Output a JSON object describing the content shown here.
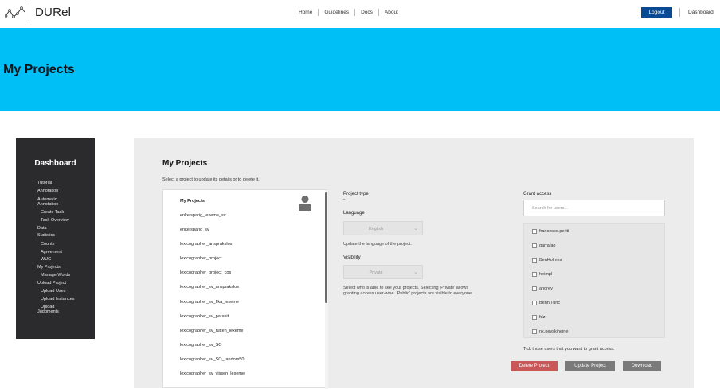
{
  "app": {
    "name": "DURel"
  },
  "nav": {
    "links": [
      "Home",
      "Guidelines",
      "Docs",
      "About"
    ],
    "logout_label": "Logout",
    "dashboard_label": "Dashboard"
  },
  "banner": {
    "title": "My Projects"
  },
  "sidebar": {
    "title": "Dashboard",
    "items": [
      {
        "label": "Tutorial",
        "indent": 0
      },
      {
        "label": "Annotation",
        "indent": 0
      },
      {
        "label": "Automatic",
        "indent": 0
      },
      {
        "label": "Annotation",
        "indent": 0
      },
      {
        "label": "Create Task",
        "indent": 1
      },
      {
        "label": "Task Overview",
        "indent": 1
      },
      {
        "label": "Data",
        "indent": 0
      },
      {
        "label": "Statistics",
        "indent": 0
      },
      {
        "label": "Counts",
        "indent": 1
      },
      {
        "label": "Agreement",
        "indent": 1
      },
      {
        "label": "WUG",
        "indent": 1
      },
      {
        "label": "My Projects",
        "indent": 0
      },
      {
        "label": "Manage Words",
        "indent": 1
      },
      {
        "label": "Upload Project",
        "indent": 0
      },
      {
        "label": "Upload Uses",
        "indent": 1
      },
      {
        "label": "Upload Instances",
        "indent": 1
      },
      {
        "label": "Upload",
        "indent": 1
      },
      {
        "label": "Judgments",
        "indent": 1
      }
    ]
  },
  "main": {
    "title": "My Projects",
    "subtitle": "Select a project to update its details or to delete it.",
    "projects": [
      "My Projects",
      "enkelsparig_lexeme_sv",
      "enkelsparig_sv",
      "lexicographer_ansprakslos",
      "lexicographer_project",
      "lexicographer_project_cos",
      "lexicographer_sv_ansprakslos",
      "lexicographer_sv_fika_lexeme",
      "lexicographer_sv_parasit",
      "lexicographer_sv_rutten_lexeme",
      "lexicographer_sv_SO",
      "lexicographer_sv_SO_random50",
      "lexicographer_sv_vissen_lexeme"
    ],
    "project_type_label": "Project type",
    "project_type_value": "-",
    "language_label": "Language",
    "language_value": "English",
    "language_hint": "Update the language of the project.",
    "visibility_label": "Visibility",
    "visibility_value": "Private",
    "visibility_hint_1": "Select who is able to see your projects. Selecting 'Private' allows",
    "visibility_hint_2": "granting access user-wise. 'Public' projects are visible to everyone.",
    "grant_label": "Grant access",
    "search_placeholder": "Search for users...",
    "users": [
      "francesco.periti",
      "garrafao",
      "BenHolmes",
      "heimpl",
      "andrey",
      "BenniTunc",
      "fdz",
      "nk.nevskiheine"
    ],
    "grant_hint": "Tick those users that you want to grant access.",
    "delete_label": "Delete Project",
    "update_label": "Update Project",
    "download_label": "Download"
  }
}
